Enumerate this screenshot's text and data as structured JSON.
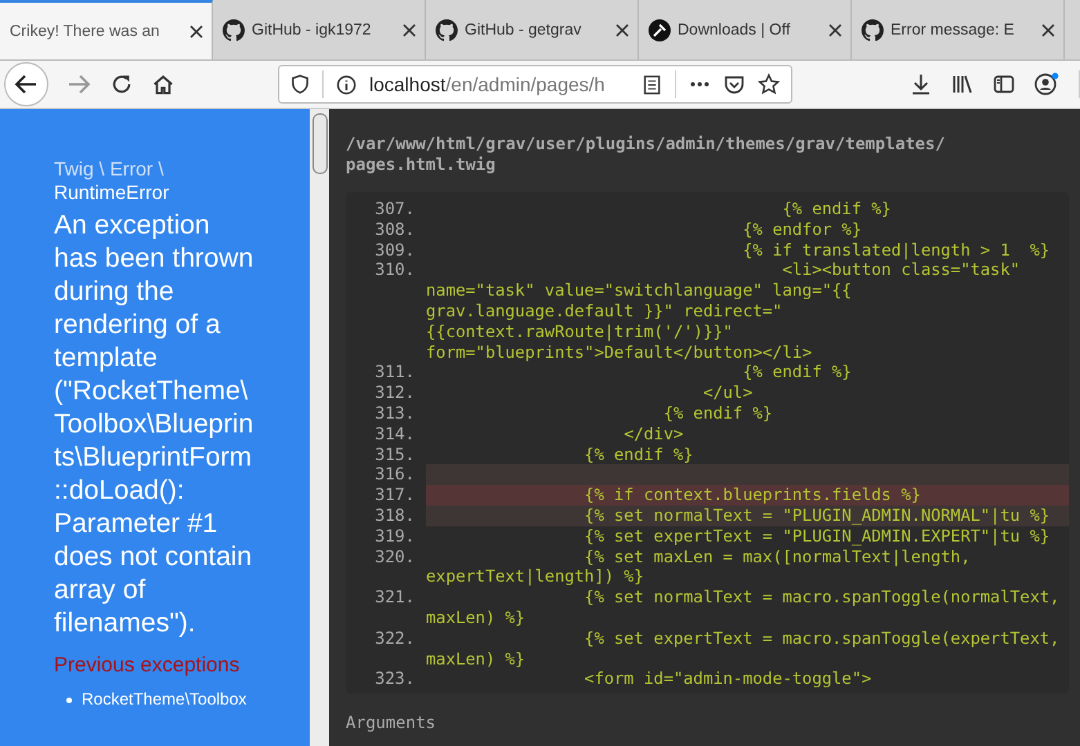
{
  "tabs": [
    {
      "label": "Crikey! There was an",
      "kind": "plain",
      "selected": true
    },
    {
      "label": "GitHub - igk1972",
      "kind": "github",
      "selected": false
    },
    {
      "label": "GitHub - getgrav",
      "kind": "github",
      "selected": false
    },
    {
      "label": "Downloads | Off",
      "kind": "tool",
      "selected": false
    },
    {
      "label": "Error message: E",
      "kind": "github",
      "selected": false
    }
  ],
  "address_bar": {
    "host": "localhost",
    "path": "/en/admin/pages/h"
  },
  "error": {
    "class_prefix": "Twig \\ Error \\",
    "class_name": "RuntimeError",
    "message": "An exception has been thrown during the rendering of a template (\"RocketTheme\\Toolbox\\Blueprints\\BlueprintForm::doLoad(): Parameter #1 does not contain array of filenames\").",
    "previous_heading": "Previous exceptions",
    "previous": [
      "RocketTheme\\Toolbox"
    ]
  },
  "file_path": "/var/www/html/grav/user/plugins/admin/themes/grav/templates/pages.html.twig",
  "code_lines": [
    {
      "number": "307.",
      "code": "                                    {% endif %}",
      "kind": "normal"
    },
    {
      "number": "308.",
      "code": "                                {% endfor %}",
      "kind": "normal"
    },
    {
      "number": "309.",
      "code": "                                {% if translated|length > 1  %}",
      "kind": "normal"
    },
    {
      "number": "310.",
      "code": "                                    <li><button class=\"task\" name=\"task\" value=\"switchlanguage\" lang=\"{{ grav.language.default }}\" redirect=\"{{context.rawRoute|trim('/')}}\" form=\"blueprints\">Default</button></li>",
      "kind": "normal"
    },
    {
      "number": "311.",
      "code": "                                {% endif %}",
      "kind": "normal"
    },
    {
      "number": "312.",
      "code": "                            </ul>",
      "kind": "normal"
    },
    {
      "number": "313.",
      "code": "                        {% endif %}",
      "kind": "normal"
    },
    {
      "number": "314.",
      "code": "                    </div>",
      "kind": "normal"
    },
    {
      "number": "315.",
      "code": "                {% endif %}",
      "kind": "normal"
    },
    {
      "number": "316.",
      "kind": "near"
    },
    {
      "number": "317.",
      "code": "                {% if context.blueprints.fields %}",
      "kind": "error"
    },
    {
      "number": "318.",
      "code": "                {% set normalText = \"PLUGIN_ADMIN.NORMAL\"|tu %}",
      "kind": "near"
    },
    {
      "number": "319.",
      "code": "                {% set expertText = \"PLUGIN_ADMIN.EXPERT\"|tu %}",
      "kind": "normal"
    },
    {
      "number": "320.",
      "code": "                {% set maxLen = max([normalText|length, expertText|length]) %}",
      "kind": "normal"
    },
    {
      "number": "321.",
      "code": "                {% set normalText = macro.spanToggle(normalText, maxLen) %}",
      "kind": "normal"
    },
    {
      "number": "322.",
      "code": "                {% set expertText = macro.spanToggle(expertText, maxLen) %}",
      "kind": "normal"
    },
    {
      "number": "323.",
      "code": "                <form id=\"admin-mode-toggle\">",
      "kind": "normal"
    }
  ],
  "arguments_heading": "Arguments"
}
